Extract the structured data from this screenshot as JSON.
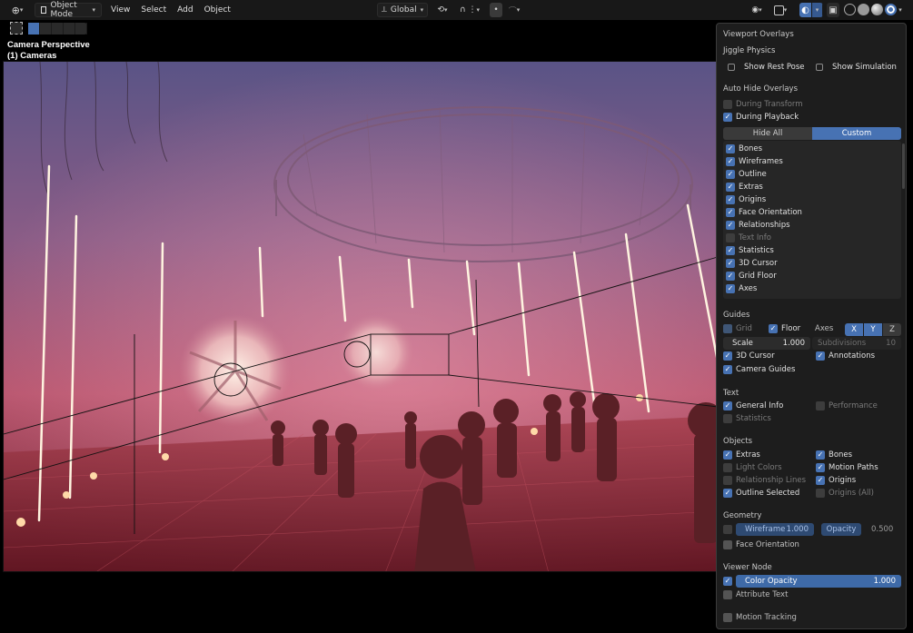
{
  "header": {
    "mode_label": "Object Mode",
    "menus": [
      "View",
      "Select",
      "Add",
      "Object"
    ],
    "orientation_label": "Global"
  },
  "viewport": {
    "title": "Camera Perspective",
    "subtitle": "(1) Cameras"
  },
  "panel": {
    "title": "Viewport Overlays",
    "jiggle": {
      "heading": "Jiggle Physics",
      "show_rest_pose": "Show Rest Pose",
      "show_simulation": "Show Simulation"
    },
    "autohide": {
      "heading": "Auto Hide Overlays",
      "during_transform": "During Transform",
      "during_playback": "During Playback",
      "tab_hide_all": "Hide All",
      "tab_custom": "Custom",
      "items": [
        {
          "label": "Bones",
          "checked": true
        },
        {
          "label": "Wireframes",
          "checked": true
        },
        {
          "label": "Outline",
          "checked": true
        },
        {
          "label": "Extras",
          "checked": true
        },
        {
          "label": "Origins",
          "checked": true
        },
        {
          "label": "Face Orientation",
          "checked": true
        },
        {
          "label": "Relationships",
          "checked": true
        },
        {
          "label": "Text Info",
          "checked": false
        },
        {
          "label": "Statistics",
          "checked": true
        },
        {
          "label": "3D Cursor",
          "checked": true
        },
        {
          "label": "Grid Floor",
          "checked": true
        },
        {
          "label": "Axes",
          "checked": true
        }
      ]
    },
    "guides": {
      "heading": "Guides",
      "grid": "Grid",
      "floor": "Floor",
      "axes": "Axes",
      "axis_x": "X",
      "axis_y": "Y",
      "axis_z": "Z",
      "scale_label": "Scale",
      "scale_value": "1.000",
      "subdivisions_label": "Subdivisions",
      "subdivisions_value": "10",
      "cursor_3d": "3D Cursor",
      "annotations": "Annotations",
      "camera_guides": "Camera Guides"
    },
    "text": {
      "heading": "Text",
      "general_info": "General Info",
      "performance": "Performance",
      "statistics": "Statistics"
    },
    "objects": {
      "heading": "Objects",
      "extras": "Extras",
      "bones": "Bones",
      "light_colors": "Light Colors",
      "motion_paths": "Motion Paths",
      "relationship_lines": "Relationship Lines",
      "origins": "Origins",
      "outline_selected": "Outline Selected",
      "origins_all": "Origins (All)"
    },
    "geometry": {
      "heading": "Geometry",
      "wireframe_label": "Wireframe",
      "wireframe_value": "1.000",
      "opacity_label": "Opacity",
      "opacity_value": "0.500",
      "face_orientation": "Face Orientation"
    },
    "viewer_node": {
      "heading": "Viewer Node",
      "color_opacity_label": "Color Opacity",
      "color_opacity_value": "1.000",
      "attribute_text": "Attribute Text"
    },
    "motion_tracking": "Motion Tracking"
  },
  "colors": {
    "accent": "#4772b3",
    "panel_bg": "#1d1d1d",
    "header_bg": "#181818"
  }
}
